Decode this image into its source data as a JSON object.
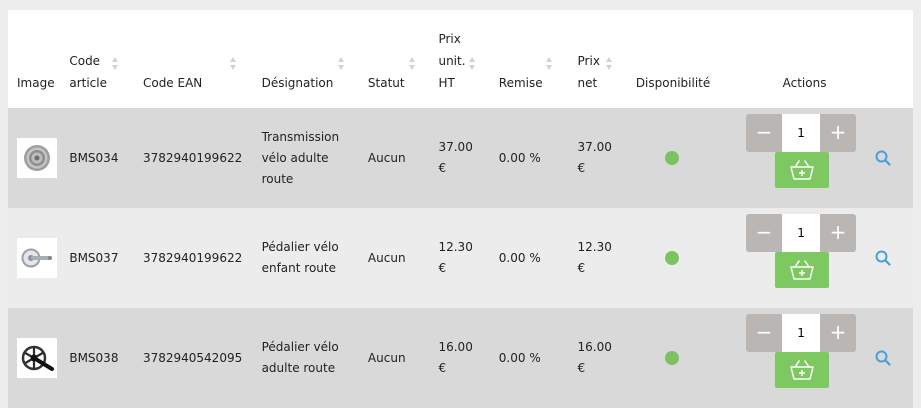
{
  "headers": {
    "image": "Image",
    "code_article": "Code article",
    "code_ean": "Code EAN",
    "designation": "Désignation",
    "statut": "Statut",
    "prix_ht": "Prix unit. HT",
    "remise": "Remise",
    "prix_net": "Prix net",
    "disponibilite": "Disponibilité",
    "actions": "Actions"
  },
  "rows": [
    {
      "image_icon": "bike-cassette-image",
      "code": "BMS034",
      "ean": "3782940199622",
      "designation": "Transmission vélo adulte route",
      "statut": "Aucun",
      "prix_ht": "37.00 €",
      "remise": "0.00 %",
      "prix_net": "37.00 €",
      "availability_color": "#7cc35f",
      "qty": "1"
    },
    {
      "image_icon": "crankset-image",
      "code": "BMS037",
      "ean": "3782940199622",
      "designation": "Pédalier vélo enfant route",
      "statut": "Aucun",
      "prix_ht": "12.30 €",
      "remise": "0.00 %",
      "prix_net": "12.30 €",
      "availability_color": "#7cc35f",
      "qty": "1"
    },
    {
      "image_icon": "crankset-black-image",
      "code": "BMS038",
      "ean": "3782940542095",
      "designation": "Pédalier vélo adulte route",
      "statut": "Aucun",
      "prix_ht": "16.00 €",
      "remise": "0.00 %",
      "prix_net": "16.00 €",
      "availability_color": "#7cc35f",
      "qty": "1"
    }
  ],
  "controls": {
    "minus": "−",
    "plus": "+"
  },
  "colors": {
    "available": "#7cc35f",
    "cart_button": "#7dc860",
    "stepper": "#b9b6b4",
    "search_icon": "#4a9fd6"
  }
}
